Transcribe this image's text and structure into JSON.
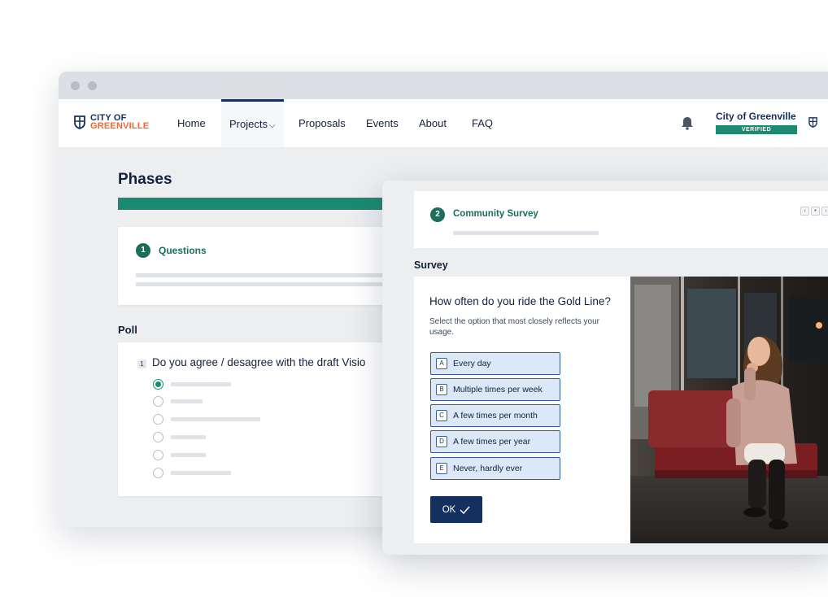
{
  "logo": {
    "line1": "CITY OF",
    "line2": "GREENVILLE"
  },
  "nav": {
    "items": [
      {
        "label": "Home",
        "active": false
      },
      {
        "label": "Projects",
        "active": true,
        "chevron": "chevron-down-icon"
      },
      {
        "label": "Proposals",
        "active": false
      },
      {
        "label": "Events",
        "active": false
      },
      {
        "label": "About",
        "active": false
      },
      {
        "label": "FAQ",
        "active": false
      }
    ],
    "bell_icon": "bell-icon",
    "org_name": "City of Greenville",
    "org_badge": "VERIFIED"
  },
  "phases": {
    "title": "Phases",
    "current_step": {
      "number": "1",
      "title": "Questions"
    }
  },
  "poll": {
    "title": "Poll",
    "question_number": "1",
    "question": "Do you agree / desagree with the draft Visio",
    "options_count": 6,
    "selected_index": 0
  },
  "survey_window": {
    "step": {
      "number": "2",
      "title": "Community Survey"
    },
    "pager": {
      "prev": "‹",
      "middle": "•",
      "next": "›"
    },
    "section_title": "Survey",
    "question": "How often do you ride the Gold Line?",
    "help_text": "Select the option that most closely reflects your usage.",
    "options": [
      {
        "key": "A",
        "label": "Every day"
      },
      {
        "key": "B",
        "label": "Multiple times per week"
      },
      {
        "key": "C",
        "label": "A few times per month"
      },
      {
        "key": "D",
        "label": "A few times per year"
      },
      {
        "key": "E",
        "label": "Never, hardly ever"
      }
    ],
    "ok_label": "OK",
    "photo": "woman-sitting-on-subway-train"
  },
  "colors": {
    "navy": "#13305f",
    "teal": "#1c8a72",
    "dark_teal": "#1b6d5c",
    "orange": "#f3662b",
    "option_fill": "#dce8f7",
    "option_border": "#2e5aa6"
  }
}
